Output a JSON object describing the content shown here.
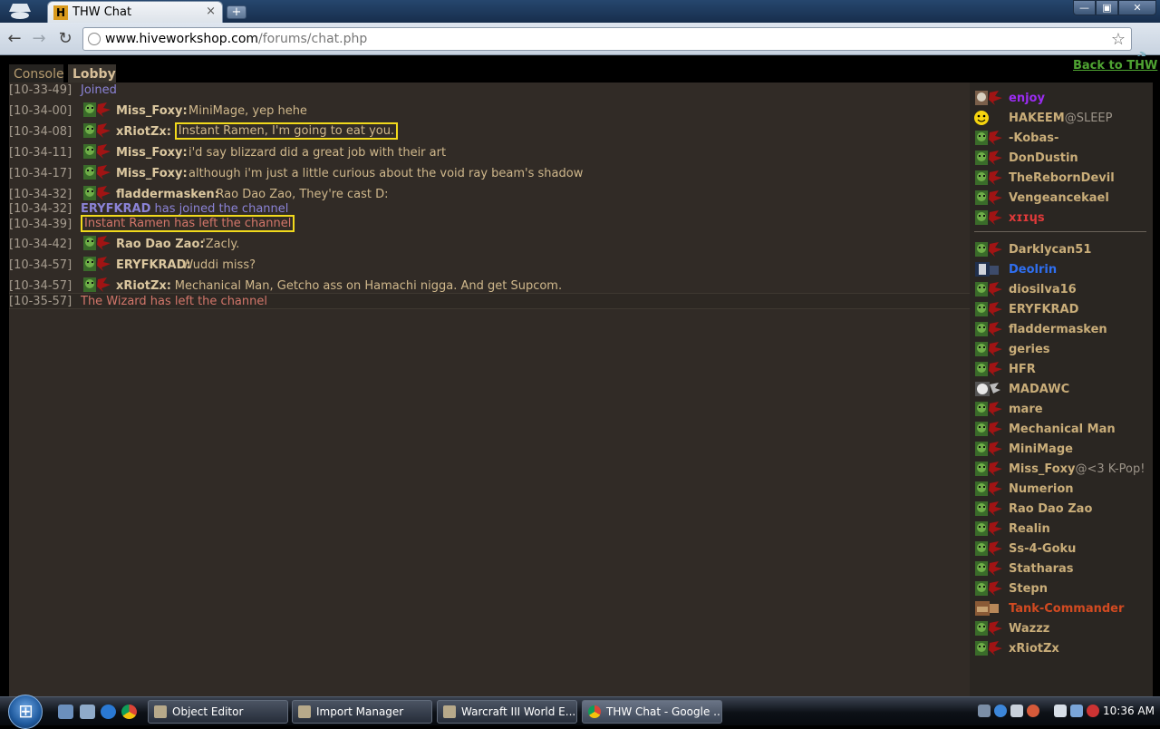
{
  "browser": {
    "tab_title": "THW Chat",
    "tab_favicon": "H",
    "tab_close": "×",
    "new_tab": "+",
    "url_host": "www.hiveworkshop.com",
    "url_path": "/forums/chat.php",
    "window_buttons": {
      "minimize": "—",
      "maximize": "▣",
      "close": "✕"
    }
  },
  "page": {
    "tabs": [
      {
        "label": "Console"
      },
      {
        "label": "Lobby"
      }
    ],
    "back_link": "Back to THW"
  },
  "chat": {
    "messages": [
      {
        "time": "[10-33-49]",
        "type": "system",
        "text": "Joined",
        "color": "#8b83d6"
      },
      {
        "time": "[10-34-00]",
        "type": "msg",
        "user": "Miss_Foxy:",
        "text": "MiniMage, yep hehe"
      },
      {
        "time": "[10-34-08]",
        "type": "msg",
        "user": "xRiotZx:",
        "text": "Instant Ramen, I'm going to eat you.",
        "highlight": true
      },
      {
        "time": "[10-34-11]",
        "type": "msg",
        "user": "Miss_Foxy:",
        "text": "i'd say blizzard did a great job with their art"
      },
      {
        "time": "[10-34-17]",
        "type": "msg",
        "user": "Miss_Foxy:",
        "text": "although i'm just a little curious about the void ray beam's shadow"
      },
      {
        "time": "[10-34-32]",
        "type": "msg",
        "user": "fladdermasken:",
        "text": "Rao Dao Zao, They're cast D:"
      },
      {
        "time": "[10-34-32]",
        "type": "join",
        "user": "ERYFKRAD",
        "text": " has joined the channel",
        "color": "#8b83d6"
      },
      {
        "time": "[10-34-39]",
        "type": "leave",
        "text": "Instant Ramen has left the channel",
        "color": "#d2766a",
        "highlight": true
      },
      {
        "time": "[10-34-42]",
        "type": "msg",
        "user": "Rao Dao Zao:",
        "text": "'Zacly."
      },
      {
        "time": "[10-34-57]",
        "type": "msg",
        "user": "ERYFKRAD:",
        "text": "Wuddi miss?"
      },
      {
        "time": "[10-34-57]",
        "type": "msg",
        "user": "xRiotZx:",
        "text": "Mechanical Man, Getcho ass on Hamachi nigga. And get Supcom."
      },
      {
        "time": "[10-35-57]",
        "type": "leave",
        "text": "The Wizard has left the channel",
        "color": "#d2766a"
      }
    ]
  },
  "userlist": {
    "top": [
      {
        "name": "enjoy",
        "color": "#9b2cf2",
        "avatar": "skull-avatar"
      },
      {
        "name": "HAKEEM",
        "status": "@SLEEP",
        "color": "#c9ad79",
        "avatar": "smiley-avatar"
      },
      {
        "name": "-Kobas-",
        "color": "#c9ad79",
        "avatar": "orc-avatar"
      },
      {
        "name": "DonDustin",
        "color": "#c9ad79",
        "avatar": "orc-avatar"
      },
      {
        "name": "TheRebornDevil",
        "color": "#c9ad79",
        "avatar": "orc-avatar"
      },
      {
        "name": "Vengeancekael",
        "color": "#c9ad79",
        "avatar": "orc-avatar"
      },
      {
        "name": "xɪɪɥs",
        "color": "#e03a3a",
        "avatar": "orc-avatar"
      }
    ],
    "bottom": [
      {
        "name": "Darklycan51",
        "color": "#c9ad79",
        "avatar": "orc-avatar"
      },
      {
        "name": "Deolrin",
        "color": "#2f6ff0",
        "avatar": "knight-avatar"
      },
      {
        "name": "diosilva16",
        "color": "#c9ad79",
        "avatar": "orc-avatar"
      },
      {
        "name": "ERYFKRAD",
        "color": "#c9ad79",
        "avatar": "orc-avatar"
      },
      {
        "name": "fladdermasken",
        "color": "#c9ad79",
        "avatar": "orc-avatar"
      },
      {
        "name": "geries",
        "color": "#c9ad79",
        "avatar": "orc-avatar"
      },
      {
        "name": "HFR",
        "color": "#c9ad79",
        "avatar": "orc-avatar"
      },
      {
        "name": "MADAWC",
        "color": "#c9ad79",
        "avatar": "wolf-avatar"
      },
      {
        "name": "mare",
        "color": "#c9ad79",
        "avatar": "orc-avatar"
      },
      {
        "name": "Mechanical Man",
        "color": "#c9ad79",
        "avatar": "orc-avatar"
      },
      {
        "name": "MiniMage",
        "color": "#c9ad79",
        "avatar": "orc-avatar"
      },
      {
        "name": "Miss_Foxy",
        "status": "@<3 K-Pop!",
        "color": "#c9ad79",
        "avatar": "orc-avatar"
      },
      {
        "name": "Numerion",
        "color": "#c9ad79",
        "avatar": "orc-avatar"
      },
      {
        "name": "Rao Dao Zao",
        "color": "#c9ad79",
        "avatar": "orc-avatar"
      },
      {
        "name": "Realin",
        "color": "#c9ad79",
        "avatar": "orc-avatar"
      },
      {
        "name": "Ss-4-Goku",
        "color": "#c9ad79",
        "avatar": "orc-avatar"
      },
      {
        "name": "Statharas",
        "color": "#c9ad79",
        "avatar": "orc-avatar"
      },
      {
        "name": "Stepn",
        "color": "#c9ad79",
        "avatar": "orc-avatar"
      },
      {
        "name": "Tank-Commander",
        "color": "#d24a21",
        "avatar": "tank-avatar"
      },
      {
        "name": "Wazzz",
        "color": "#c9ad79",
        "avatar": "orc-avatar"
      },
      {
        "name": "xRiotZx",
        "color": "#c9ad79",
        "avatar": "orc-avatar"
      }
    ]
  },
  "taskbar": {
    "tasks": [
      {
        "label": "Object Editor"
      },
      {
        "label": "Import Manager"
      },
      {
        "label": "Warcraft III World E..."
      },
      {
        "label": "THW Chat - Google ..."
      }
    ],
    "clock": "10:36 AM"
  }
}
